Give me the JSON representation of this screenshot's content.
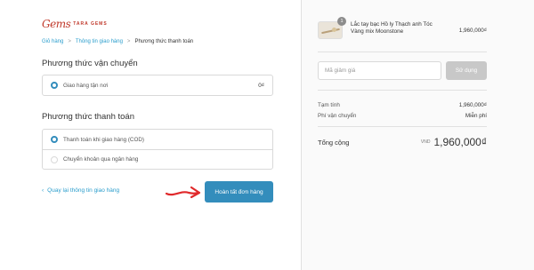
{
  "brand": {
    "mark": "Gems",
    "name": "TARA GEMS"
  },
  "breadcrumb": {
    "cart": "Giỏ hàng",
    "shipping_info": "Thông tin giao hàng",
    "current": "Phương thức thanh toán",
    "separator": ">"
  },
  "shipping": {
    "title": "Phương thức vận chuyển",
    "option": {
      "label": "Giao hàng tận nơi",
      "price": "0₫",
      "selected": true
    }
  },
  "payment": {
    "title": "Phương thức thanh toán",
    "options": [
      {
        "label": "Thanh toán khi giao hàng (COD)",
        "selected": true
      },
      {
        "label": "Chuyển khoản qua ngân hàng",
        "selected": false
      }
    ]
  },
  "actions": {
    "back_label": "Quay lại thông tin giao hàng",
    "back_icon": "chevron-left-icon",
    "submit_label": "Hoàn tất đơn hàng"
  },
  "annotation_color": "#e0292b",
  "order": {
    "item": {
      "name": "Lắc tay bạc Hồ ly Thạch anh Tóc Vàng mix Moonstone",
      "quantity": "1",
      "price": "1,960,000₫"
    },
    "discount": {
      "placeholder": "Mã giảm giá",
      "apply_label": "Sử dụng"
    },
    "subtotal": {
      "label": "Tạm tính",
      "value": "1,960,000₫"
    },
    "shipping_fee": {
      "label": "Phí vận chuyển",
      "value": "Miễn phí"
    },
    "total": {
      "label": "Tổng cộng",
      "currency": "VND",
      "value": "1,960,000₫"
    }
  },
  "colors": {
    "accent": "#338dbc",
    "link": "#2a9dcc",
    "brand": "#c0392b",
    "disabled_button": "#c8c8c8"
  }
}
